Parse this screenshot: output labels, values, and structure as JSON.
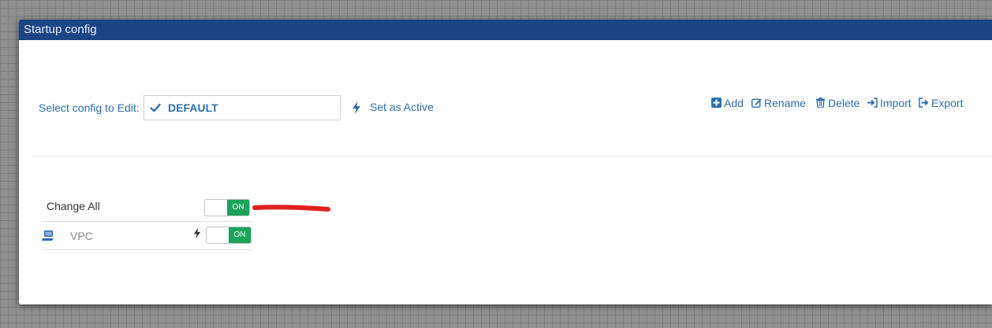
{
  "dialog": {
    "title": "Startup config"
  },
  "config_selector": {
    "label": "Select config to Edit:",
    "selected_value": "DEFAULT",
    "check_icon": "check-icon"
  },
  "set_active": {
    "label": "Set as Active",
    "icon": "bolt-icon"
  },
  "actions": [
    {
      "label": "Add",
      "icon": "plus-square-icon"
    },
    {
      "label": "Rename",
      "icon": "edit-icon"
    },
    {
      "label": "Delete",
      "icon": "trash-icon"
    },
    {
      "label": "Import",
      "icon": "sign-in-icon"
    },
    {
      "label": "Export",
      "icon": "sign-out-icon"
    }
  ],
  "rows": {
    "change_all": {
      "label": "Change All",
      "toggle_text": "ON",
      "state": "on"
    },
    "vpc": {
      "label": "VPC",
      "toggle_text": "ON",
      "state": "on",
      "icon": "computer-icon",
      "status_icon": "bolt-icon"
    }
  },
  "colors": {
    "titlebar": "#1b4585",
    "link": "#2f6faa",
    "toggle_on": "#1aa35b",
    "annotation": "#e02020"
  }
}
